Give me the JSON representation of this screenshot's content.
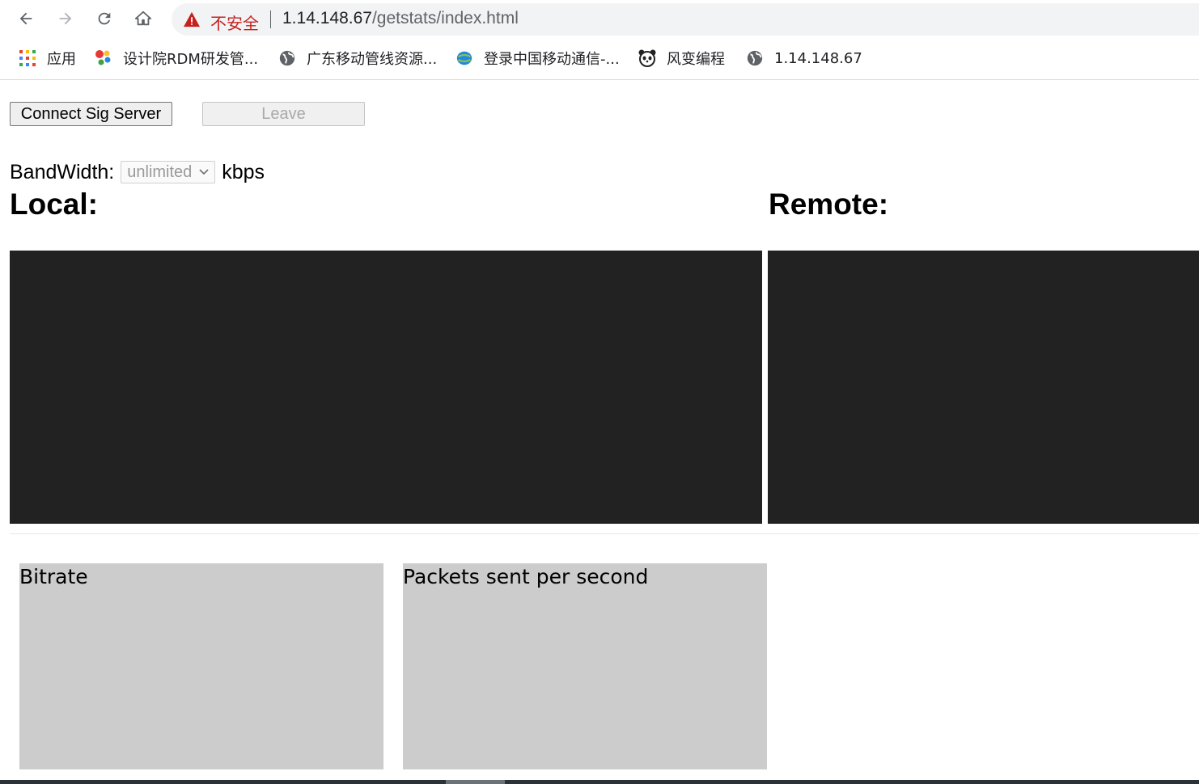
{
  "browser": {
    "security_label": "不安全",
    "url_host": "1.14.148.67",
    "url_path": "/getstats/index.html",
    "bookmarks": [
      {
        "label": "应用",
        "icon": "apps-grid-icon"
      },
      {
        "label": "设计院RDM研发管...",
        "icon": "colorful-dots-icon"
      },
      {
        "label": "广东移动管线资源...",
        "icon": "globe-icon"
      },
      {
        "label": "登录中国移动通信-...",
        "icon": "china-mobile-icon"
      },
      {
        "label": "风变编程",
        "icon": "panda-icon"
      },
      {
        "label": "1.14.148.67",
        "icon": "globe-icon"
      }
    ]
  },
  "controls": {
    "connect_label": "Connect Sig Server",
    "leave_label": "Leave",
    "bandwidth_label": "BandWidth:",
    "bandwidth_value": "unlimited",
    "bandwidth_unit": "kbps"
  },
  "headings": {
    "local": "Local:",
    "remote": "Remote:"
  },
  "graphs": {
    "bitrate_title": "Bitrate",
    "packets_title": "Packets sent per second"
  },
  "colors": {
    "video_bg": "#222222",
    "graph_bg": "#cccccc",
    "insecure_red": "#c5221f"
  }
}
